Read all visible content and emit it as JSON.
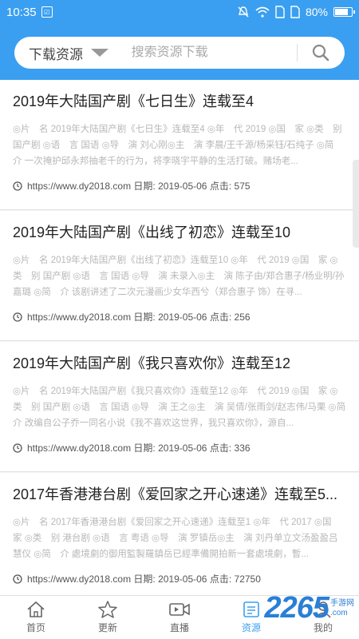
{
  "status": {
    "time": "10:35",
    "battery": "80%",
    "battery_level": 0.8
  },
  "search": {
    "scope_label": "下载资源",
    "placeholder": "搜索资源下载"
  },
  "items": [
    {
      "title": "2019年大陆国产剧《七日生》连载至4",
      "desc": "◎片　名 2019年大陆国产剧《七日生》连载至4 ◎年　代 2019 ◎国　家 ◎类　别 国产剧 ◎语　言 国语 ◎导　演 刘心刚◎主　演 李晨/王千源/杨采钰/石纯子 ◎简　介 一次掩护邱永邦抽老千的行为，将李晓宇平静的生活打破。赌场老...",
      "url": "https://www.dy2018.com",
      "date_label": "日期:",
      "date": "2019-05-06",
      "clicks_label": "点击:",
      "clicks": "575"
    },
    {
      "title": "2019年大陆国产剧《出线了初恋》连载至10",
      "desc": "◎片　名 2019年大陆国产剧《出线了初恋》连载至10 ◎年　代 2019 ◎国　家 ◎类　别 国产剧 ◎语　言 国语 ◎导　演 未录入◎主　演 陈子由/郑合惠子/杨业明/孙嘉璐 ◎简　介 该剧讲述了二次元漫画少女华西兮（郑合惠子 饰）在寻...",
      "url": "https://www.dy2018.com",
      "date_label": "日期:",
      "date": "2019-05-06",
      "clicks_label": "点击:",
      "clicks": "256"
    },
    {
      "title": "2019年大陆国产剧《我只喜欢你》连载至12",
      "desc": "◎片　名 2019年大陆国产剧《我只喜欢你》连载至12 ◎年　代 2019 ◎国　家 ◎类　别 国产剧 ◎语　言 国语 ◎导　演 王之◎主　演 吴倩/张雨剑/赵志伟/马栗 ◎简　介 改编自公子乔一同名小说《我不喜欢这世界，我只喜欢你》，源自...",
      "url": "https://www.dy2018.com",
      "date_label": "日期:",
      "date": "2019-05-06",
      "clicks_label": "点击:",
      "clicks": "336"
    },
    {
      "title": "2017年香港港台剧《爱回家之开心速递》连载至5...",
      "desc": "◎片　名 2017年香港港台剧《爱回家之开心速递》连载至1 ◎年　代 2017 ◎国　家 ◎类　别 港台剧 ◎语　言 粤语 ◎导　演 罗镇岳◎主　演 刘丹单立文汤盈盈吕慧仪 ◎简　介 處境劇的御用監製羅鎮岳已經準備開拍新一套處境劇，暫...",
      "url": "https://www.dy2018.com",
      "date_label": "日期:",
      "date": "2019-05-06",
      "clicks_label": "点击:",
      "clicks": "72750"
    }
  ],
  "tabs": [
    {
      "label": "首页",
      "icon": "home-icon"
    },
    {
      "label": "更新",
      "icon": "star-icon"
    },
    {
      "label": "直播",
      "icon": "video-icon"
    },
    {
      "label": "资源",
      "icon": "resource-icon"
    },
    {
      "label": "我的",
      "icon": "user-icon"
    }
  ],
  "active_tab": 3,
  "watermark": {
    "number": "2265",
    "suffix": ".com",
    "text": "手游网"
  },
  "colors": {
    "accent": "#3a9ff0",
    "watermark": "#2a7fd6"
  }
}
